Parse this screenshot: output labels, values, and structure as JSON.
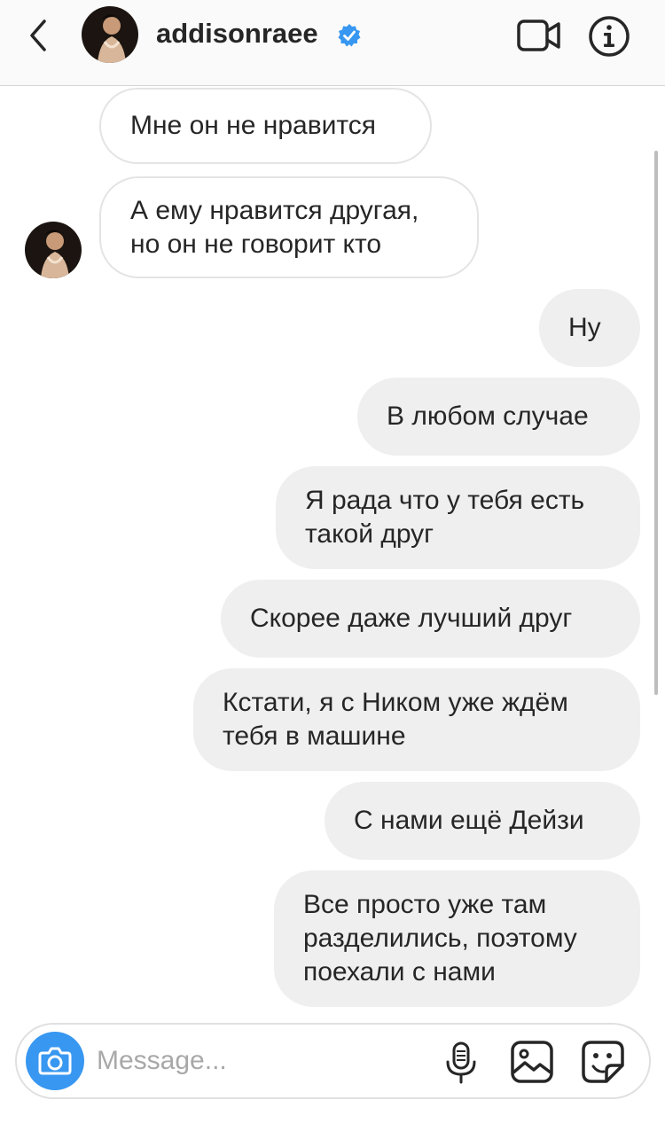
{
  "header": {
    "username": "addisonraee",
    "verified": true,
    "icons": [
      "back-chevron-icon",
      "verified-badge-icon",
      "video-call-icon",
      "info-icon"
    ]
  },
  "messages": [
    {
      "from": "them",
      "text_lines": [
        "Мне он не нравится"
      ]
    },
    {
      "from": "them",
      "text_lines": [
        "А ему нравится другая,",
        "но он не говорит кто"
      ]
    },
    {
      "from": "me",
      "text_lines": [
        "Ну"
      ]
    },
    {
      "from": "me",
      "text_lines": [
        "В любом случае"
      ]
    },
    {
      "from": "me",
      "text_lines": [
        "Я рада что у тебя есть",
        "такой друг"
      ]
    },
    {
      "from": "me",
      "text_lines": [
        "Скорее даже лучший друг"
      ]
    },
    {
      "from": "me",
      "text_lines": [
        "Кстати, я с Ником уже ждём",
        "тебя в машине"
      ]
    },
    {
      "from": "me",
      "text_lines": [
        "С нами ещё Дейзи"
      ]
    },
    {
      "from": "me",
      "text_lines": [
        "Все просто уже там",
        "разделились, поэтому",
        "поехали с нами"
      ]
    }
  ],
  "composer": {
    "placeholder": "Message...",
    "value": "",
    "icons": [
      "camera-icon",
      "microphone-icon",
      "gallery-icon",
      "sticker-icon"
    ]
  },
  "colors": {
    "accent_blue": "#3897f0",
    "outgoing_bubble": "#efefef",
    "incoming_border": "#e4e4e4",
    "header_bg": "#fafafa"
  }
}
